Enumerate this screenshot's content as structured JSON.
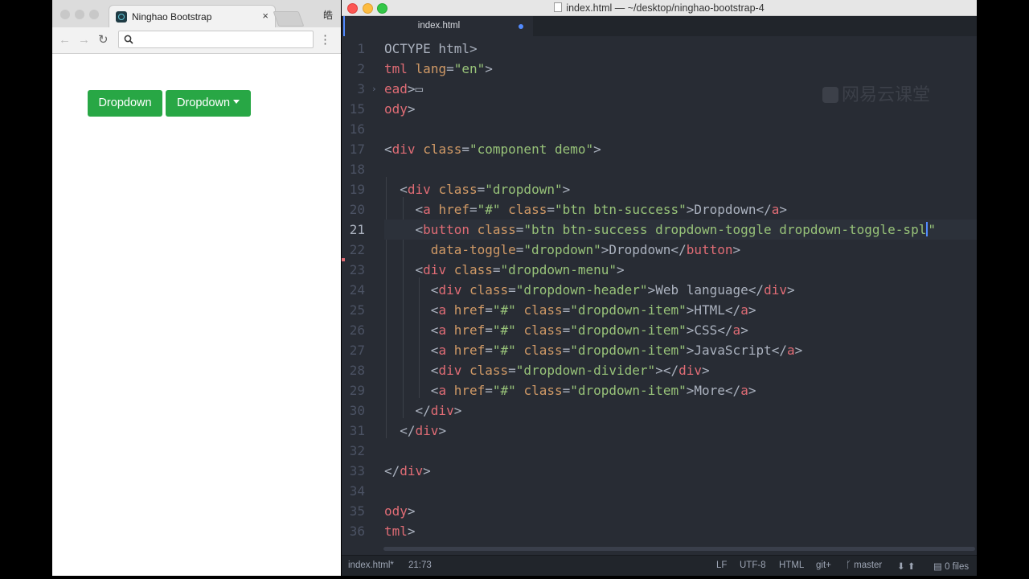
{
  "browser": {
    "tab_title": "Ninghao Bootstrap",
    "tab_close": "×",
    "profile_glyph": "皓",
    "back_icon": "←",
    "forward_icon": "→",
    "reload_icon": "↻",
    "menu_icon": "⋮",
    "url_value": "",
    "page": {
      "button_1": "Dropdown",
      "button_2": "Dropdown",
      "button_color": "#28a745"
    }
  },
  "editor": {
    "window_title": "index.html — ~/desktop/ninghao-bootstrap-4",
    "tab_title": "index.html",
    "watermark": "网易云课堂",
    "lines": [
      {
        "n": "1",
        "tokens": [
          {
            "t": "OCTYPE html>",
            "c": ""
          }
        ]
      },
      {
        "n": "2",
        "tokens": [
          {
            "t": "tml",
            "c": "tag"
          },
          {
            "t": " ",
            "c": ""
          },
          {
            "t": "lang",
            "c": "attr"
          },
          {
            "t": "=",
            "c": ""
          },
          {
            "t": "\"en\"",
            "c": "str"
          },
          {
            "t": ">",
            "c": ""
          }
        ]
      },
      {
        "n": "3",
        "tokens": [
          {
            "t": "ead",
            "c": "tag"
          },
          {
            "t": ">",
            "c": ""
          },
          {
            "t": "▭",
            "c": ""
          }
        ]
      },
      {
        "n": "15",
        "tokens": [
          {
            "t": "ody",
            "c": "tag"
          },
          {
            "t": ">",
            "c": ""
          }
        ]
      },
      {
        "n": "16",
        "tokens": []
      },
      {
        "n": "17",
        "tokens": [
          {
            "t": "<",
            "c": ""
          },
          {
            "t": "div",
            "c": "tag"
          },
          {
            "t": " ",
            "c": ""
          },
          {
            "t": "class",
            "c": "attr"
          },
          {
            "t": "=",
            "c": ""
          },
          {
            "t": "\"component demo\"",
            "c": "str"
          },
          {
            "t": ">",
            "c": ""
          }
        ]
      },
      {
        "n": "18",
        "tokens": []
      },
      {
        "n": "19",
        "tokens": [
          {
            "t": "  <",
            "c": ""
          },
          {
            "t": "div",
            "c": "tag"
          },
          {
            "t": " ",
            "c": ""
          },
          {
            "t": "class",
            "c": "attr"
          },
          {
            "t": "=",
            "c": ""
          },
          {
            "t": "\"dropdown\"",
            "c": "str"
          },
          {
            "t": ">",
            "c": ""
          }
        ]
      },
      {
        "n": "20",
        "tokens": [
          {
            "t": "    <",
            "c": ""
          },
          {
            "t": "a",
            "c": "tag"
          },
          {
            "t": " ",
            "c": ""
          },
          {
            "t": "href",
            "c": "attr"
          },
          {
            "t": "=",
            "c": ""
          },
          {
            "t": "\"#\"",
            "c": "str"
          },
          {
            "t": " ",
            "c": ""
          },
          {
            "t": "class",
            "c": "attr"
          },
          {
            "t": "=",
            "c": ""
          },
          {
            "t": "\"btn btn-success\"",
            "c": "str"
          },
          {
            "t": ">Dropdown</",
            "c": ""
          },
          {
            "t": "a",
            "c": "tag"
          },
          {
            "t": ">",
            "c": ""
          }
        ]
      },
      {
        "n": "21",
        "tokens": [
          {
            "t": "    <",
            "c": ""
          },
          {
            "t": "button",
            "c": "tag"
          },
          {
            "t": " ",
            "c": ""
          },
          {
            "t": "class",
            "c": "attr"
          },
          {
            "t": "=",
            "c": ""
          },
          {
            "t": "\"btn btn-success dropdown-toggle dropdown-toggle-spl",
            "c": "str"
          },
          {
            "t": "",
            "c": "cursor"
          },
          {
            "t": "\"",
            "c": "str"
          }
        ]
      },
      {
        "n": "22",
        "tokens": [
          {
            "t": "      ",
            "c": ""
          },
          {
            "t": "data-toggle",
            "c": "attr"
          },
          {
            "t": "=",
            "c": ""
          },
          {
            "t": "\"dropdown\"",
            "c": "str"
          },
          {
            "t": ">Dropdown</",
            "c": ""
          },
          {
            "t": "button",
            "c": "tag"
          },
          {
            "t": ">",
            "c": ""
          }
        ]
      },
      {
        "n": "23",
        "tokens": [
          {
            "t": "    <",
            "c": ""
          },
          {
            "t": "div",
            "c": "tag"
          },
          {
            "t": " ",
            "c": ""
          },
          {
            "t": "class",
            "c": "attr"
          },
          {
            "t": "=",
            "c": ""
          },
          {
            "t": "\"dropdown-menu\"",
            "c": "str"
          },
          {
            "t": ">",
            "c": ""
          }
        ]
      },
      {
        "n": "24",
        "tokens": [
          {
            "t": "      <",
            "c": ""
          },
          {
            "t": "div",
            "c": "tag"
          },
          {
            "t": " ",
            "c": ""
          },
          {
            "t": "class",
            "c": "attr"
          },
          {
            "t": "=",
            "c": ""
          },
          {
            "t": "\"dropdown-header\"",
            "c": "str"
          },
          {
            "t": ">Web language</",
            "c": ""
          },
          {
            "t": "div",
            "c": "tag"
          },
          {
            "t": ">",
            "c": ""
          }
        ]
      },
      {
        "n": "25",
        "tokens": [
          {
            "t": "      <",
            "c": ""
          },
          {
            "t": "a",
            "c": "tag"
          },
          {
            "t": " ",
            "c": ""
          },
          {
            "t": "href",
            "c": "attr"
          },
          {
            "t": "=",
            "c": ""
          },
          {
            "t": "\"#\"",
            "c": "str"
          },
          {
            "t": " ",
            "c": ""
          },
          {
            "t": "class",
            "c": "attr"
          },
          {
            "t": "=",
            "c": ""
          },
          {
            "t": "\"dropdown-item\"",
            "c": "str"
          },
          {
            "t": ">HTML</",
            "c": ""
          },
          {
            "t": "a",
            "c": "tag"
          },
          {
            "t": ">",
            "c": ""
          }
        ]
      },
      {
        "n": "26",
        "tokens": [
          {
            "t": "      <",
            "c": ""
          },
          {
            "t": "a",
            "c": "tag"
          },
          {
            "t": " ",
            "c": ""
          },
          {
            "t": "href",
            "c": "attr"
          },
          {
            "t": "=",
            "c": ""
          },
          {
            "t": "\"#\"",
            "c": "str"
          },
          {
            "t": " ",
            "c": ""
          },
          {
            "t": "class",
            "c": "attr"
          },
          {
            "t": "=",
            "c": ""
          },
          {
            "t": "\"dropdown-item\"",
            "c": "str"
          },
          {
            "t": ">CSS</",
            "c": ""
          },
          {
            "t": "a",
            "c": "tag"
          },
          {
            "t": ">",
            "c": ""
          }
        ]
      },
      {
        "n": "27",
        "tokens": [
          {
            "t": "      <",
            "c": ""
          },
          {
            "t": "a",
            "c": "tag"
          },
          {
            "t": " ",
            "c": ""
          },
          {
            "t": "href",
            "c": "attr"
          },
          {
            "t": "=",
            "c": ""
          },
          {
            "t": "\"#\"",
            "c": "str"
          },
          {
            "t": " ",
            "c": ""
          },
          {
            "t": "class",
            "c": "attr"
          },
          {
            "t": "=",
            "c": ""
          },
          {
            "t": "\"dropdown-item\"",
            "c": "str"
          },
          {
            "t": ">JavaScript</",
            "c": ""
          },
          {
            "t": "a",
            "c": "tag"
          },
          {
            "t": ">",
            "c": ""
          }
        ]
      },
      {
        "n": "28",
        "tokens": [
          {
            "t": "      <",
            "c": ""
          },
          {
            "t": "div",
            "c": "tag"
          },
          {
            "t": " ",
            "c": ""
          },
          {
            "t": "class",
            "c": "attr"
          },
          {
            "t": "=",
            "c": ""
          },
          {
            "t": "\"dropdown-divider\"",
            "c": "str"
          },
          {
            "t": "></",
            "c": ""
          },
          {
            "t": "div",
            "c": "tag"
          },
          {
            "t": ">",
            "c": ""
          }
        ]
      },
      {
        "n": "29",
        "tokens": [
          {
            "t": "      <",
            "c": ""
          },
          {
            "t": "a",
            "c": "tag"
          },
          {
            "t": " ",
            "c": ""
          },
          {
            "t": "href",
            "c": "attr"
          },
          {
            "t": "=",
            "c": ""
          },
          {
            "t": "\"#\"",
            "c": "str"
          },
          {
            "t": " ",
            "c": ""
          },
          {
            "t": "class",
            "c": "attr"
          },
          {
            "t": "=",
            "c": ""
          },
          {
            "t": "\"dropdown-item\"",
            "c": "str"
          },
          {
            "t": ">More</",
            "c": ""
          },
          {
            "t": "a",
            "c": "tag"
          },
          {
            "t": ">",
            "c": ""
          }
        ]
      },
      {
        "n": "30",
        "tokens": [
          {
            "t": "    </",
            "c": ""
          },
          {
            "t": "div",
            "c": "tag"
          },
          {
            "t": ">",
            "c": ""
          }
        ]
      },
      {
        "n": "31",
        "tokens": [
          {
            "t": "  </",
            "c": ""
          },
          {
            "t": "div",
            "c": "tag"
          },
          {
            "t": ">",
            "c": ""
          }
        ]
      },
      {
        "n": "32",
        "tokens": []
      },
      {
        "n": "33",
        "tokens": [
          {
            "t": "</",
            "c": ""
          },
          {
            "t": "div",
            "c": "tag"
          },
          {
            "t": ">",
            "c": ""
          }
        ]
      },
      {
        "n": "34",
        "tokens": []
      },
      {
        "n": "35",
        "tokens": [
          {
            "t": "ody",
            "c": "tag"
          },
          {
            "t": ">",
            "c": ""
          }
        ]
      },
      {
        "n": "36",
        "tokens": [
          {
            "t": "tml",
            "c": "tag"
          },
          {
            "t": ">",
            "c": ""
          }
        ]
      }
    ],
    "current_line": "21",
    "status": {
      "file": "index.html*",
      "cursor": "21:73",
      "line_ending": "LF",
      "encoding": "UTF-8",
      "grammar": "HTML",
      "git": "git+",
      "branch": "master",
      "branch_icon": "ᚴ",
      "arrows": "⬇ ⬆",
      "files": "0 files"
    }
  }
}
